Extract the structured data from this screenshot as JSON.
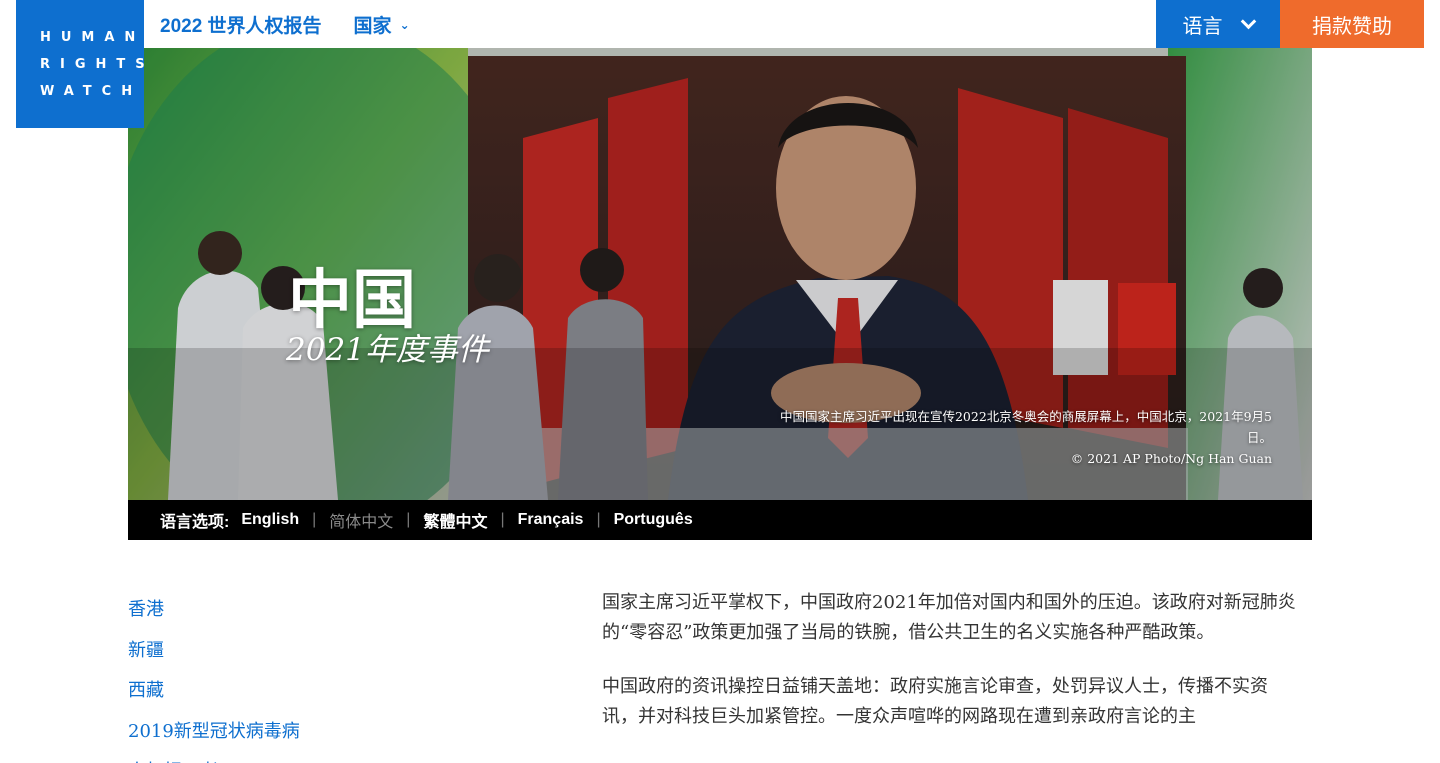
{
  "logo": {
    "lines": [
      "HUMAN",
      "RIGHTS",
      "WATCH"
    ]
  },
  "nav": {
    "report_title": "2022 世界人权报告",
    "countries_label": "国家",
    "language_label": "语言",
    "donate_label": "捐款赞助"
  },
  "hero": {
    "title": "中国",
    "subtitle": "2021年度事件",
    "caption_line1": "中国国家主席习近平出现在宣传2022北京冬奥会的商展屏幕上，中国北京，2021年9月5日。",
    "caption_credit": "© 2021 AP Photo/Ng Han Guan"
  },
  "language_bar": {
    "label": "语言选项:",
    "options": [
      "English",
      "简体中文",
      "繁體中文",
      "Français",
      "Português"
    ],
    "current": "简体中文"
  },
  "side_links": [
    "香港",
    "新疆",
    "西藏",
    "2019新型冠状病毒病",
    "人权捍卫者"
  ],
  "article": {
    "paragraphs": [
      "国家主席习近平掌权下，中国政府2021年加倍对国内和国外的压迫。该政府对新冠肺炎的“零容忍”政策更加强了当局的铁腕，借公共卫生的名义实施各种严酷政策。",
      "中国政府的资讯操控日益铺天盖地：政府实施言论审查，处罚异议人士，传播不实资讯，并对科技巨头加紧管控。一度众声喧哗的网路现在遭到亲政府言论的主"
    ]
  },
  "colors": {
    "brand_blue": "#0e6fcf",
    "donate_orange": "#ef6b2c"
  }
}
